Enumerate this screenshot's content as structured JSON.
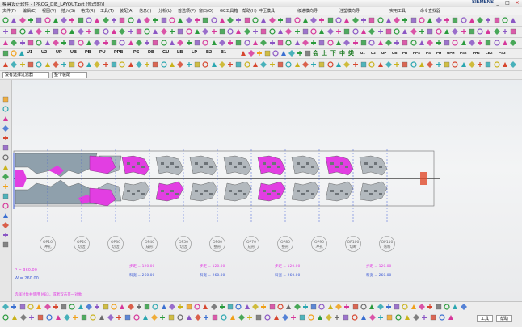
{
  "window": {
    "title": "模具设计软件 - [PROG_DIE_LAYOUT.prt (修改的)]",
    "brand": "SIEMENS",
    "controls": [
      "_",
      "□",
      "×"
    ]
  },
  "menu": [
    "文件(F)",
    "编辑(E)",
    "视图(V)",
    "插入(S)",
    "格式(R)",
    "工具(T)",
    "装配(A)",
    "信息(I)",
    "分析(L)",
    "首选项(P)",
    "窗口(O)",
    "GC工具箱",
    "帮助(H)",
    "冲压模具",
    "级进模向导",
    "注塑模向导",
    "实用工具",
    "命令查找器"
  ],
  "module_bar": [
    "U1",
    "U2",
    "UP",
    "UB",
    "PB",
    "PU",
    "PPB",
    "PS",
    "DB",
    "GU",
    "LB",
    "LP",
    "B2",
    "B1"
  ],
  "module_bar_cn": [
    "会",
    "上",
    "下",
    "中",
    "类"
  ],
  "module_bar_right": [
    "U1",
    "U2",
    "UP",
    "UB",
    "PB",
    "PPS",
    "PS",
    "PH",
    "UPH",
    "PS2",
    "PH2",
    "LB2",
    "PS3",
    "PH3",
    "LB3"
  ],
  "selection_bar": {
    "filter_value": "没有选择过滤器",
    "scope_value": "整个装配"
  },
  "stations": [
    {
      "label": "OP10",
      "sub": "冲孔"
    },
    {
      "label": "OP20",
      "sub": "切边"
    },
    {
      "label": "OP30",
      "sub": "切边"
    },
    {
      "label": "OP40",
      "sub": "成形"
    },
    {
      "label": "OP50",
      "sub": "切边"
    },
    {
      "label": "OP60",
      "sub": "整形"
    },
    {
      "label": "OP70",
      "sub": "成形"
    },
    {
      "label": "OP80",
      "sub": "整形"
    },
    {
      "label": "OP90",
      "sub": "冲孔"
    },
    {
      "label": "OP100",
      "sub": "切断"
    },
    {
      "label": "OP110",
      "sub": "落料"
    }
  ],
  "annotations": [
    {
      "line1": "步距 = 120.00",
      "line2": "料宽 = 260.00"
    },
    {
      "line1": "步距 = 120.00",
      "line2": "料宽 = 260.00"
    },
    {
      "line1": "步距 = 120.00",
      "line2": "料宽 = 260.00"
    },
    {
      "line1": "步距 = 120.00",
      "line2": "料宽 = 260.00"
    }
  ],
  "left_labels": {
    "a": "P = 360.00",
    "b": "W = 260.00"
  },
  "status_text": "选择对象并使用 MB3，或者双击某一对象",
  "bottom_buttons": {
    "ok": "工具",
    "cancel": "帮助"
  },
  "colors": {
    "magenta": "#e23ee2",
    "strip_gray": "#8fa0ac",
    "station_line": "#3d5ad6"
  }
}
